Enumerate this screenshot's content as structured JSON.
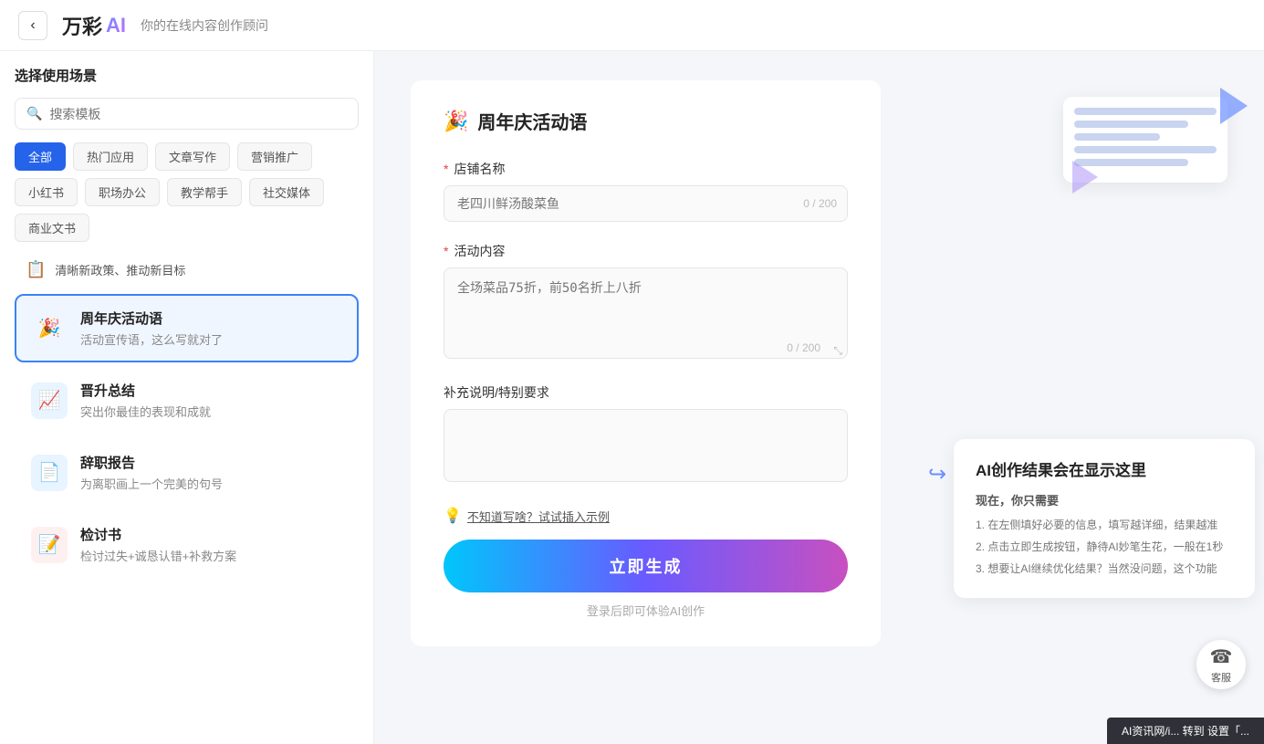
{
  "header": {
    "back_label": "‹",
    "logo_text": "万彩",
    "logo_ai": "A✦",
    "subtitle": "你的在线内容创作顾问"
  },
  "sidebar": {
    "title": "选择使用场景",
    "search_placeholder": "搜索模板",
    "tags": [
      {
        "label": "全部",
        "active": true
      },
      {
        "label": "热门应用",
        "active": false
      },
      {
        "label": "文章写作",
        "active": false
      },
      {
        "label": "营销推广",
        "active": false
      },
      {
        "label": "小红书",
        "active": false
      },
      {
        "label": "职场办公",
        "active": false
      },
      {
        "label": "教学帮手",
        "active": false
      },
      {
        "label": "社交媒体",
        "active": false
      },
      {
        "label": "商业文书",
        "active": false
      }
    ],
    "banner_item": {
      "icon": "📋",
      "text": "清晰新政策、推动新目标"
    },
    "list_items": [
      {
        "icon": "🎉",
        "icon_class": "icon-party",
        "title": "周年庆活动语",
        "desc": "活动宣传语，这么写就对了",
        "active": true
      },
      {
        "icon": "📈",
        "icon_class": "icon-up",
        "title": "晋升总结",
        "desc": "突出你最佳的表现和成就",
        "active": false
      },
      {
        "icon": "📄",
        "icon_class": "icon-doc",
        "title": "辞职报告",
        "desc": "为离职画上一个完美的句号",
        "active": false
      },
      {
        "icon": "📝",
        "icon_class": "icon-review",
        "title": "检讨书",
        "desc": "检讨过失+诚恳认错+补救方案",
        "active": false
      }
    ]
  },
  "form": {
    "title": "周年庆活动语",
    "title_icon": "🎉",
    "shop_name": {
      "label": "店铺名称",
      "placeholder": "老四川鲜汤酸菜鱼",
      "char_count": "0 / 200",
      "required": true
    },
    "activity": {
      "label": "活动内容",
      "placeholder": "全场菜品75折，前50名折上八折",
      "char_count": "0 / 200",
      "required": true
    },
    "supplement": {
      "label": "补充说明/特别要求",
      "placeholder": "",
      "required": false
    },
    "hint_icon": "💡",
    "hint_text": "不知道写啥？试试插入示例",
    "generate_btn": "立即生成",
    "login_hint": "登录后即可体验AI创作"
  },
  "right_panel": {
    "ai_title": "AI创作结果会在显示这里",
    "ai_subtitle": "现在，你只需要",
    "steps": [
      "1. 在左侧填好必要的信息，填写越详细，结果越准",
      "2. 点击立即生成按钮，静待AI妙笔生花，一般在1秒",
      "3. 想要让AI继续优化结果？当然没问题，这个功能"
    ],
    "arrow": "↩"
  },
  "cs": {
    "icon": "☎",
    "label": "客服"
  },
  "bottom_banner": "AI资讯网/i... 转到 设置「..."
}
